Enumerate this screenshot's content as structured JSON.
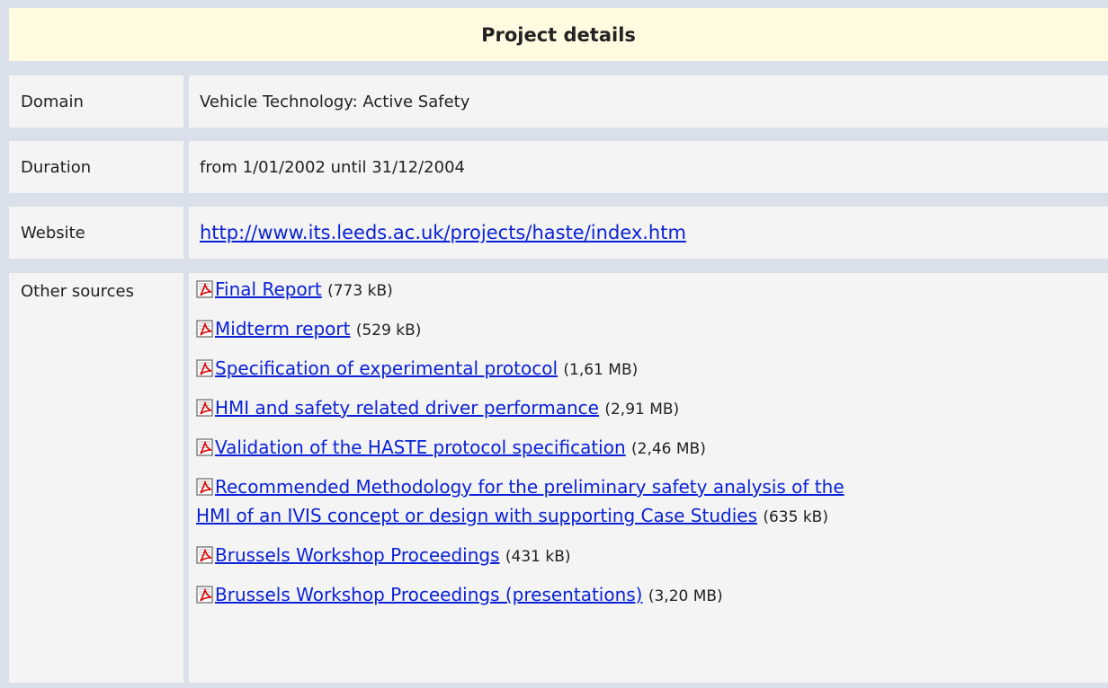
{
  "header": {
    "title": "Project details"
  },
  "rows": {
    "domain": {
      "label": "Domain",
      "value": "Vehicle Technology: Active Safety"
    },
    "duration": {
      "label": "Duration",
      "value": "from 1/01/2002 until 31/12/2004"
    },
    "website": {
      "label": "Website",
      "value": "http://www.its.leeds.ac.uk/projects/haste/index.htm"
    },
    "sources": {
      "label": "Other sources"
    }
  },
  "sources": [
    {
      "title": "Final Report",
      "size": "(773 kB)"
    },
    {
      "title": "Midterm report",
      "size": "(529 kB)"
    },
    {
      "title": "Specification of experimental protocol",
      "size": "(1,61 MB)"
    },
    {
      "title": "HMI and safety related driver performance",
      "size": "(2,91 MB)"
    },
    {
      "title": "Validation of the HASTE protocol specification",
      "size": "(2,46 MB)"
    },
    {
      "title_line1": "Recommended Methodology for the preliminary safety analysis of the",
      "title_line2": "HMI of an IVIS concept or design with supporting Case Studies",
      "size": "(635 kB)"
    },
    {
      "title": "Brussels Workshop Proceedings",
      "size": "(431 kB)"
    },
    {
      "title": "Brussels Workshop Proceedings (presentations)",
      "size": "(3,20 MB)"
    }
  ],
  "icons": {
    "pdf": "pdf-file-icon"
  },
  "colors": {
    "header_bg": "#fffae0",
    "link": "#0b22d6",
    "frame": "#d9e0ea",
    "cell_bg": "#f4f4f4"
  }
}
